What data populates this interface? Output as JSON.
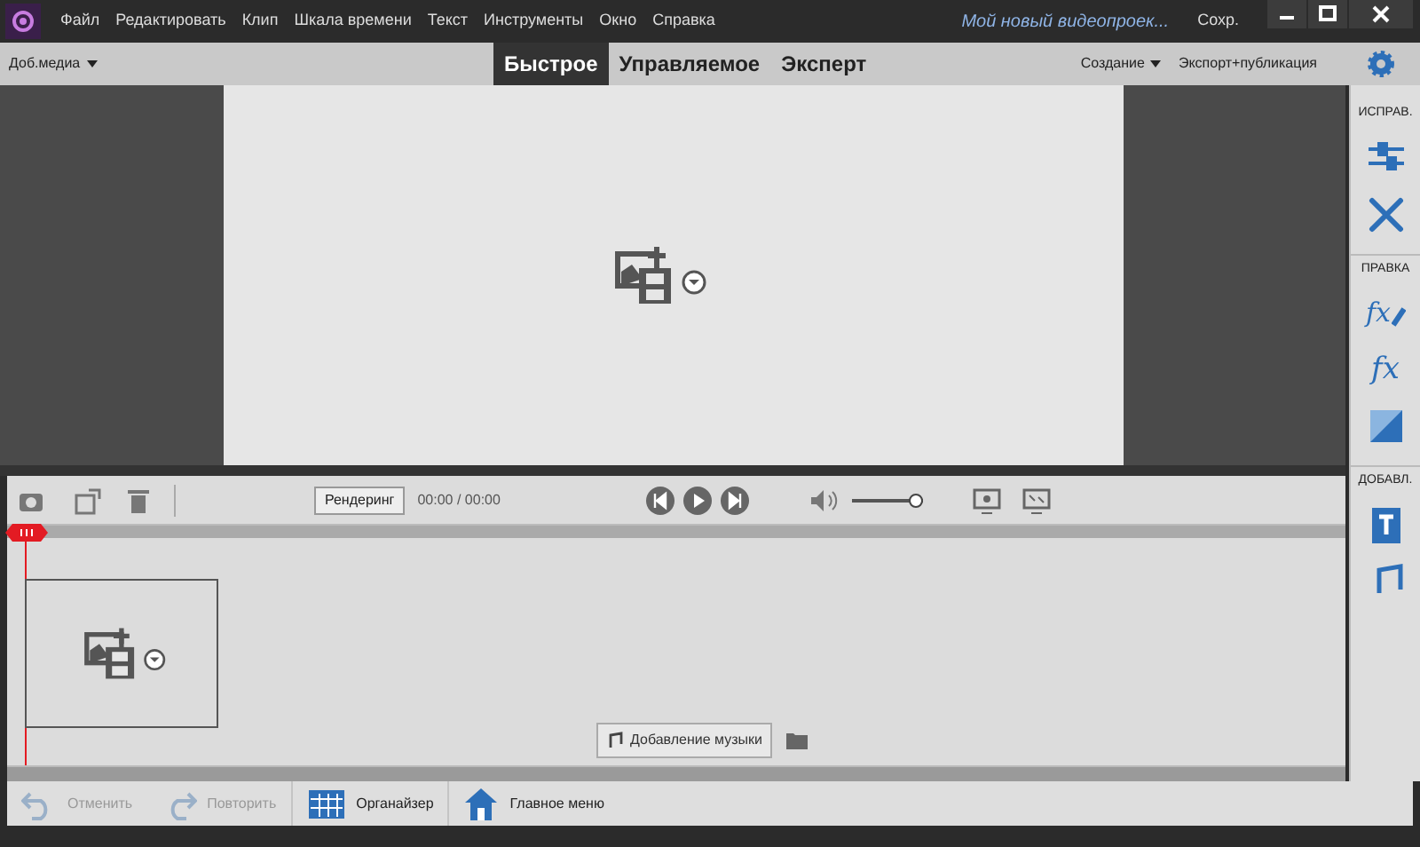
{
  "menu": [
    "Файл",
    "Редактировать",
    "Клип",
    "Шкала времени",
    "Текст",
    "Инструменты",
    "Окно",
    "Справка"
  ],
  "project_title": "Мой новый видеопроек...",
  "save": "Сохр.",
  "add_media": "Доб.медиа",
  "modes": [
    {
      "label": "Быстрое",
      "selected": true
    },
    {
      "label": "Управляемое",
      "selected": false
    },
    {
      "label": "Эксперт",
      "selected": false
    }
  ],
  "create": "Создание",
  "export": "Экспорт+публикация",
  "side_panel": [
    {
      "kind": "heading",
      "label": "ИСПРАВ."
    },
    {
      "kind": "tool"
    },
    {
      "kind": "tool"
    },
    {
      "kind": "heading",
      "label": "ПРАВКА"
    },
    {
      "kind": "glyph",
      "glyph": "fx"
    },
    {
      "kind": "glyph",
      "glyph": "fx"
    },
    {
      "kind": "tool"
    },
    {
      "kind": "heading",
      "label": "ДОБАВЛ."
    },
    {
      "kind": "tool"
    },
    {
      "kind": "tool"
    }
  ],
  "render": "Рендеринг",
  "time": "00:00 / 00:00",
  "volume": {
    "level": 0.9
  },
  "add_music": "Добавление музыки",
  "bottom": [
    {
      "label": "Отменить",
      "disabled": true
    },
    {
      "label": "Повторить",
      "disabled": true
    },
    {
      "label": "Органайзер",
      "disabled": false
    },
    {
      "label": "Главное меню",
      "disabled": false
    }
  ]
}
